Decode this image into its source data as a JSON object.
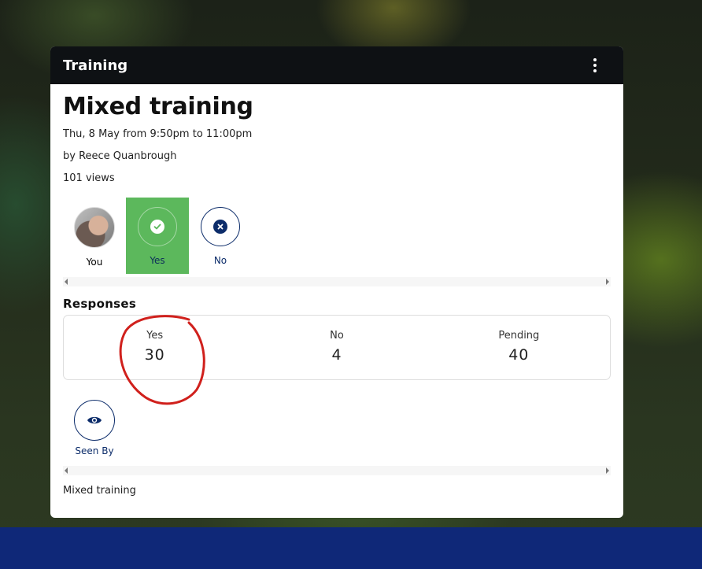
{
  "card": {
    "header_title": "Training",
    "menu_icon": "more-vertical-icon"
  },
  "event": {
    "title": "Mixed training",
    "datetime": "Thu, 8 May from 9:50pm to 11:00pm",
    "author": "by Reece Quanbrough",
    "views": "101 views",
    "description": "Mixed training"
  },
  "rsvp": {
    "options": [
      {
        "label": "You",
        "icon": "avatar-photo"
      },
      {
        "label": "Yes",
        "icon": "check-circle-icon",
        "selected": true
      },
      {
        "label": "No",
        "icon": "x-circle-icon"
      }
    ]
  },
  "responses": {
    "title": "Responses",
    "items": [
      {
        "label": "Yes",
        "count": "30"
      },
      {
        "label": "No",
        "count": "4"
      },
      {
        "label": "Pending",
        "count": "40"
      }
    ]
  },
  "seen_by": {
    "label": "Seen By",
    "icon": "eye-icon"
  },
  "colors": {
    "header_bg": "#0e1114",
    "selected_green": "#5cb85c",
    "navy": "#0c2c6a",
    "annotation_red": "#d0201c"
  }
}
